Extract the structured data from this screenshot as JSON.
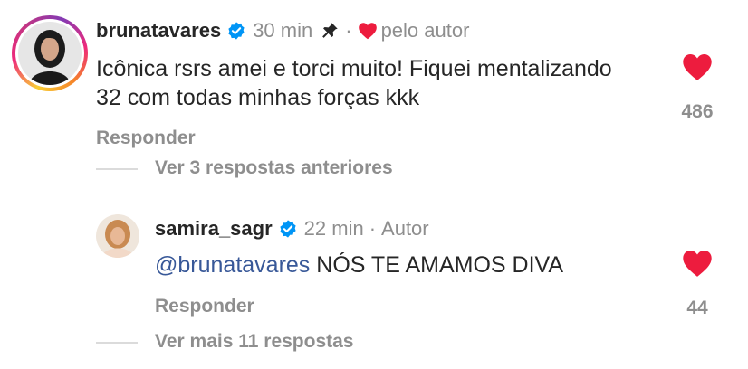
{
  "comment": {
    "username": "brunatavares",
    "time": "30 min",
    "separator": "·",
    "liked_by_author": "pelo autor",
    "text": "Icônica rsrs amei e torci muito! Fiquei mentalizando 32 com todas minhas forças kkk",
    "reply_label": "Responder",
    "like_count": "486",
    "view_previous": "Ver 3 respostas anteriores",
    "icons": {
      "verified": "verified-badge-icon",
      "pin": "pin-icon",
      "author_heart": "heart-icon",
      "like": "heart-filled-icon"
    }
  },
  "reply": {
    "username": "samira_sagr",
    "time": "22 min",
    "separator": "·",
    "author_label": "Autor",
    "mention": "@brunatavares",
    "text": "NÓS TE AMAMOS DIVA",
    "reply_label": "Responder",
    "like_count": "44",
    "view_more": "Ver mais 11 respostas"
  },
  "colors": {
    "heart": "#ed1c3e",
    "verified": "#0095f6",
    "mention": "#385898",
    "secondary_text": "#8e8e8e"
  }
}
